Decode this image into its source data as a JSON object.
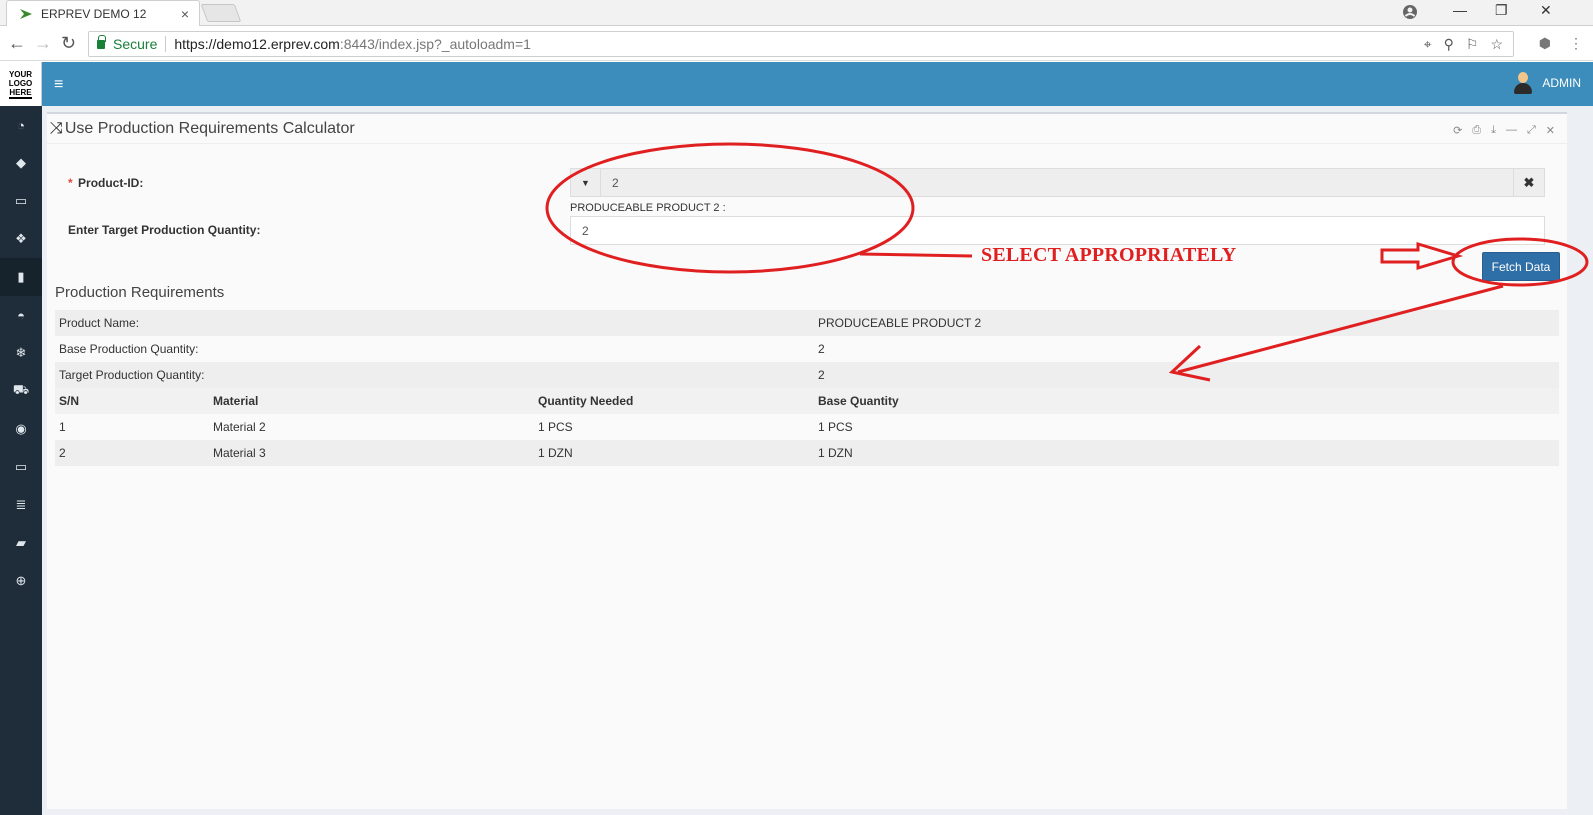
{
  "browser": {
    "tab_title": "ERPREV DEMO 12",
    "tab_close": "×",
    "secure_label": "Secure",
    "url_scheme_host": "https://demo12.erprev.com",
    "url_rest": ":8443/index.jsp?_autoloadm=1",
    "window_controls": [
      "—",
      "❐",
      "✕"
    ]
  },
  "app": {
    "logo_lines": [
      "YOUR",
      "LOGO",
      "HERE"
    ],
    "user_name": "ADMIN",
    "sidebar_icons": [
      "dashboard-icon",
      "tag-icon",
      "money-icon",
      "cubes-icon",
      "building-icon",
      "bucket-icon",
      "snowflake-icon",
      "cart-icon",
      "spotify-icon",
      "desktop-icon",
      "database-icon",
      "book-icon",
      "lifebuoy-icon"
    ]
  },
  "panel": {
    "title": "Use Production Requirements Calculator",
    "product_label": "Product-ID:",
    "required_mark": "*",
    "product_value": "2",
    "product_hint": "PRODUCEABLE PRODUCT 2 :",
    "target_label": "Enter Target Production Quantity:",
    "target_value": "2",
    "fetch_label": "Fetch Data"
  },
  "results": {
    "title": "Production Requirements",
    "summary": [
      {
        "label": "Product Name:",
        "value": "PRODUCEABLE PRODUCT 2"
      },
      {
        "label": "Base Production Quantity:",
        "value": "2"
      },
      {
        "label": "Target Production Quantity:",
        "value": "2"
      }
    ],
    "columns": [
      "S/N",
      "Material",
      "Quantity Needed",
      "Base Quantity"
    ],
    "rows": [
      [
        "1",
        "Material 2",
        "1 PCS",
        "1 PCS"
      ],
      [
        "2",
        "Material 3",
        "1 DZN",
        "1 DZN"
      ]
    ]
  },
  "annotation": {
    "text": "SELECT APPROPRIATELY",
    "color": "#e02020"
  }
}
